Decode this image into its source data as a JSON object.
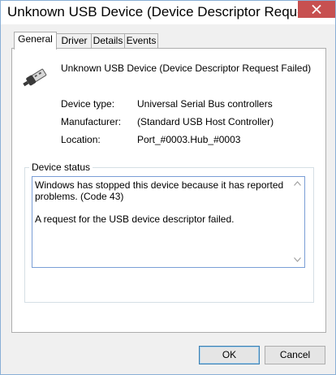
{
  "window": {
    "title": "Unknown USB Device (Device Descriptor Request Faile...",
    "close_label": "Close"
  },
  "tabs": [
    {
      "label": "General",
      "active": true
    },
    {
      "label": "Driver",
      "active": false
    },
    {
      "label": "Details",
      "active": false
    },
    {
      "label": "Events",
      "active": false
    }
  ],
  "device": {
    "icon": "usb-plug-icon",
    "name": "Unknown USB Device (Device Descriptor Request Failed)"
  },
  "properties": [
    {
      "label": "Device type:",
      "value": "Universal Serial Bus controllers"
    },
    {
      "label": "Manufacturer:",
      "value": "(Standard USB Host Controller)"
    },
    {
      "label": "Location:",
      "value": "Port_#0003.Hub_#0003"
    }
  ],
  "status": {
    "group_title": "Device status",
    "text": "Windows has stopped this device because it has reported problems. (Code 43)\n\nA request for the USB device descriptor failed."
  },
  "buttons": {
    "ok": "OK",
    "cancel": "Cancel"
  },
  "colors": {
    "close_button": "#c75050",
    "status_border": "#7a9ed6"
  }
}
